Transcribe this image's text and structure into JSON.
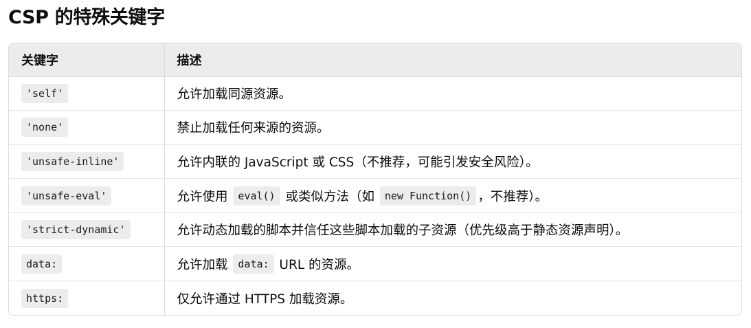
{
  "heading": "CSP 的特殊关键字",
  "table": {
    "headers": [
      "关键字",
      "描述"
    ],
    "rows": [
      {
        "keyword": "'self'",
        "desc": [
          {
            "t": "允许加载同源资源。"
          }
        ]
      },
      {
        "keyword": "'none'",
        "desc": [
          {
            "t": "禁止加载任何来源的资源。"
          }
        ]
      },
      {
        "keyword": "'unsafe-inline'",
        "desc": [
          {
            "t": "允许内联的 JavaScript 或 CSS（不推荐，可能引发安全风险）。"
          }
        ]
      },
      {
        "keyword": "'unsafe-eval'",
        "desc": [
          {
            "t": "允许使用 "
          },
          {
            "code": "eval()"
          },
          {
            "t": " 或类似方法（如 "
          },
          {
            "code": "new Function()"
          },
          {
            "t": "，不推荐）。"
          }
        ]
      },
      {
        "keyword": "'strict-dynamic'",
        "desc": [
          {
            "t": "允许动态加载的脚本并信任这些脚本加载的子资源（优先级高于静态资源声明）。"
          }
        ]
      },
      {
        "keyword": "data:",
        "desc": [
          {
            "t": "允许加载 "
          },
          {
            "code": "data:"
          },
          {
            "t": " URL 的资源。"
          }
        ]
      },
      {
        "keyword": "https:",
        "desc": [
          {
            "t": "仅允许通过 HTTPS 加载资源。"
          }
        ]
      }
    ]
  }
}
